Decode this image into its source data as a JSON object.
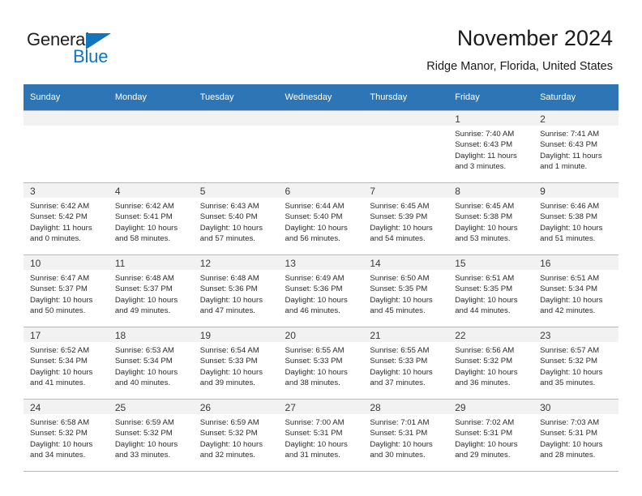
{
  "logo": {
    "word_top": "General",
    "word_bottom": "Blue",
    "triangle_color": "#1275bc",
    "text_color": "#231f20"
  },
  "header": {
    "title": "November 2024",
    "location": "Ridge Manor, Florida, United States"
  },
  "theme": {
    "header_bg": "#2e75b6",
    "header_text": "#ffffff",
    "daynum_band_bg": "#f2f2f2",
    "cell_border": "#b8b8b8",
    "body_text": "#2b2b2b"
  },
  "weekday_headers": [
    "Sunday",
    "Monday",
    "Tuesday",
    "Wednesday",
    "Thursday",
    "Friday",
    "Saturday"
  ],
  "weeks": [
    [
      {
        "empty": true
      },
      {
        "empty": true
      },
      {
        "empty": true
      },
      {
        "empty": true
      },
      {
        "empty": true
      },
      {
        "day": "1",
        "sunrise": "Sunrise: 7:40 AM",
        "sunset": "Sunset: 6:43 PM",
        "daylight_line1": "Daylight: 11 hours",
        "daylight_line2": "and 3 minutes."
      },
      {
        "day": "2",
        "sunrise": "Sunrise: 7:41 AM",
        "sunset": "Sunset: 6:43 PM",
        "daylight_line1": "Daylight: 11 hours",
        "daylight_line2": "and 1 minute."
      }
    ],
    [
      {
        "day": "3",
        "sunrise": "Sunrise: 6:42 AM",
        "sunset": "Sunset: 5:42 PM",
        "daylight_line1": "Daylight: 11 hours",
        "daylight_line2": "and 0 minutes."
      },
      {
        "day": "4",
        "sunrise": "Sunrise: 6:42 AM",
        "sunset": "Sunset: 5:41 PM",
        "daylight_line1": "Daylight: 10 hours",
        "daylight_line2": "and 58 minutes."
      },
      {
        "day": "5",
        "sunrise": "Sunrise: 6:43 AM",
        "sunset": "Sunset: 5:40 PM",
        "daylight_line1": "Daylight: 10 hours",
        "daylight_line2": "and 57 minutes."
      },
      {
        "day": "6",
        "sunrise": "Sunrise: 6:44 AM",
        "sunset": "Sunset: 5:40 PM",
        "daylight_line1": "Daylight: 10 hours",
        "daylight_line2": "and 56 minutes."
      },
      {
        "day": "7",
        "sunrise": "Sunrise: 6:45 AM",
        "sunset": "Sunset: 5:39 PM",
        "daylight_line1": "Daylight: 10 hours",
        "daylight_line2": "and 54 minutes."
      },
      {
        "day": "8",
        "sunrise": "Sunrise: 6:45 AM",
        "sunset": "Sunset: 5:38 PM",
        "daylight_line1": "Daylight: 10 hours",
        "daylight_line2": "and 53 minutes."
      },
      {
        "day": "9",
        "sunrise": "Sunrise: 6:46 AM",
        "sunset": "Sunset: 5:38 PM",
        "daylight_line1": "Daylight: 10 hours",
        "daylight_line2": "and 51 minutes."
      }
    ],
    [
      {
        "day": "10",
        "sunrise": "Sunrise: 6:47 AM",
        "sunset": "Sunset: 5:37 PM",
        "daylight_line1": "Daylight: 10 hours",
        "daylight_line2": "and 50 minutes."
      },
      {
        "day": "11",
        "sunrise": "Sunrise: 6:48 AM",
        "sunset": "Sunset: 5:37 PM",
        "daylight_line1": "Daylight: 10 hours",
        "daylight_line2": "and 49 minutes."
      },
      {
        "day": "12",
        "sunrise": "Sunrise: 6:48 AM",
        "sunset": "Sunset: 5:36 PM",
        "daylight_line1": "Daylight: 10 hours",
        "daylight_line2": "and 47 minutes."
      },
      {
        "day": "13",
        "sunrise": "Sunrise: 6:49 AM",
        "sunset": "Sunset: 5:36 PM",
        "daylight_line1": "Daylight: 10 hours",
        "daylight_line2": "and 46 minutes."
      },
      {
        "day": "14",
        "sunrise": "Sunrise: 6:50 AM",
        "sunset": "Sunset: 5:35 PM",
        "daylight_line1": "Daylight: 10 hours",
        "daylight_line2": "and 45 minutes."
      },
      {
        "day": "15",
        "sunrise": "Sunrise: 6:51 AM",
        "sunset": "Sunset: 5:35 PM",
        "daylight_line1": "Daylight: 10 hours",
        "daylight_line2": "and 44 minutes."
      },
      {
        "day": "16",
        "sunrise": "Sunrise: 6:51 AM",
        "sunset": "Sunset: 5:34 PM",
        "daylight_line1": "Daylight: 10 hours",
        "daylight_line2": "and 42 minutes."
      }
    ],
    [
      {
        "day": "17",
        "sunrise": "Sunrise: 6:52 AM",
        "sunset": "Sunset: 5:34 PM",
        "daylight_line1": "Daylight: 10 hours",
        "daylight_line2": "and 41 minutes."
      },
      {
        "day": "18",
        "sunrise": "Sunrise: 6:53 AM",
        "sunset": "Sunset: 5:34 PM",
        "daylight_line1": "Daylight: 10 hours",
        "daylight_line2": "and 40 minutes."
      },
      {
        "day": "19",
        "sunrise": "Sunrise: 6:54 AM",
        "sunset": "Sunset: 5:33 PM",
        "daylight_line1": "Daylight: 10 hours",
        "daylight_line2": "and 39 minutes."
      },
      {
        "day": "20",
        "sunrise": "Sunrise: 6:55 AM",
        "sunset": "Sunset: 5:33 PM",
        "daylight_line1": "Daylight: 10 hours",
        "daylight_line2": "and 38 minutes."
      },
      {
        "day": "21",
        "sunrise": "Sunrise: 6:55 AM",
        "sunset": "Sunset: 5:33 PM",
        "daylight_line1": "Daylight: 10 hours",
        "daylight_line2": "and 37 minutes."
      },
      {
        "day": "22",
        "sunrise": "Sunrise: 6:56 AM",
        "sunset": "Sunset: 5:32 PM",
        "daylight_line1": "Daylight: 10 hours",
        "daylight_line2": "and 36 minutes."
      },
      {
        "day": "23",
        "sunrise": "Sunrise: 6:57 AM",
        "sunset": "Sunset: 5:32 PM",
        "daylight_line1": "Daylight: 10 hours",
        "daylight_line2": "and 35 minutes."
      }
    ],
    [
      {
        "day": "24",
        "sunrise": "Sunrise: 6:58 AM",
        "sunset": "Sunset: 5:32 PM",
        "daylight_line1": "Daylight: 10 hours",
        "daylight_line2": "and 34 minutes."
      },
      {
        "day": "25",
        "sunrise": "Sunrise: 6:59 AM",
        "sunset": "Sunset: 5:32 PM",
        "daylight_line1": "Daylight: 10 hours",
        "daylight_line2": "and 33 minutes."
      },
      {
        "day": "26",
        "sunrise": "Sunrise: 6:59 AM",
        "sunset": "Sunset: 5:32 PM",
        "daylight_line1": "Daylight: 10 hours",
        "daylight_line2": "and 32 minutes."
      },
      {
        "day": "27",
        "sunrise": "Sunrise: 7:00 AM",
        "sunset": "Sunset: 5:31 PM",
        "daylight_line1": "Daylight: 10 hours",
        "daylight_line2": "and 31 minutes."
      },
      {
        "day": "28",
        "sunrise": "Sunrise: 7:01 AM",
        "sunset": "Sunset: 5:31 PM",
        "daylight_line1": "Daylight: 10 hours",
        "daylight_line2": "and 30 minutes."
      },
      {
        "day": "29",
        "sunrise": "Sunrise: 7:02 AM",
        "sunset": "Sunset: 5:31 PM",
        "daylight_line1": "Daylight: 10 hours",
        "daylight_line2": "and 29 minutes."
      },
      {
        "day": "30",
        "sunrise": "Sunrise: 7:03 AM",
        "sunset": "Sunset: 5:31 PM",
        "daylight_line1": "Daylight: 10 hours",
        "daylight_line2": "and 28 minutes."
      }
    ]
  ]
}
